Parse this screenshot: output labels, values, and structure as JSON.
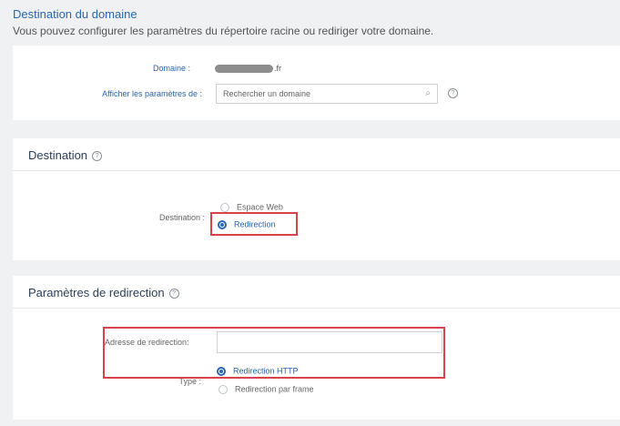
{
  "header": {
    "title": "Destination du domaine",
    "description": "Vous pouvez configurer les paramètres du répertoire racine ou rediriger votre domaine."
  },
  "domain_panel": {
    "domain_label": "Domaine :",
    "domain_suffix": ".fr",
    "show_settings_label": "Afficher les paramètres de :",
    "search_placeholder": "Rechercher un domaine"
  },
  "destination_panel": {
    "title": "Destination",
    "field_label": "Destination :",
    "options": [
      {
        "label": "Espace Web",
        "selected": false
      },
      {
        "label": "Redirection",
        "selected": true
      }
    ]
  },
  "redirect_panel": {
    "title": "Paramètres de redirection",
    "address_label": "Adresse de redirection:",
    "address_value": "",
    "type_label": "Type :",
    "type_options": [
      {
        "label": "Redirection HTTP",
        "selected": true
      },
      {
        "label": "Redirection par frame",
        "selected": false
      }
    ]
  },
  "colors": {
    "accent": "#2a67b1",
    "highlight": "#d9424a",
    "background": "#f0f1f3"
  },
  "icons": {
    "help": "help-icon",
    "search": "search-icon",
    "radio": "radio-icon"
  }
}
